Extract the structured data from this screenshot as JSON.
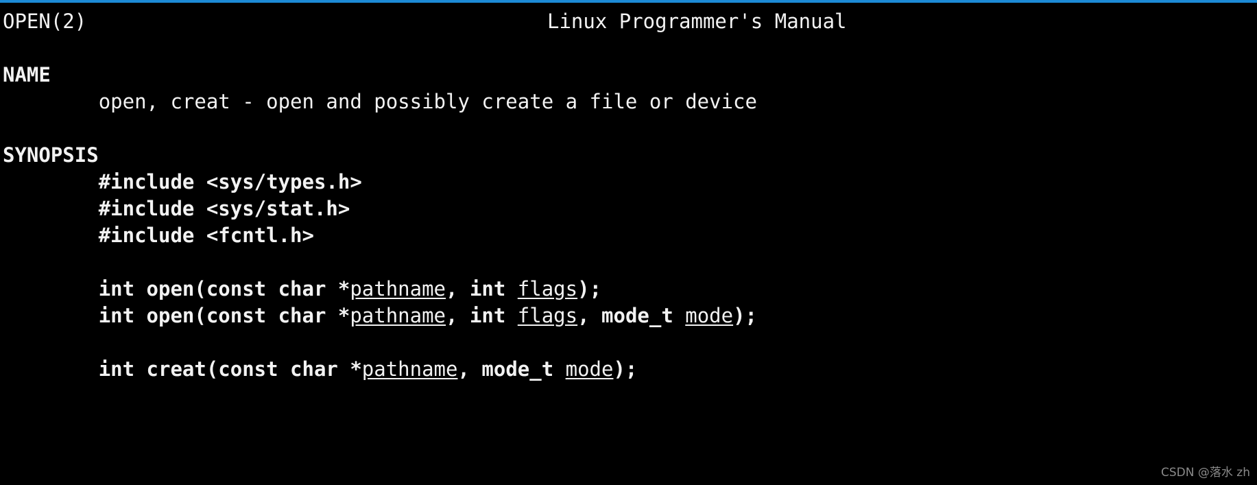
{
  "theme": {
    "background": "#000000",
    "foreground": "#f2f2f2",
    "accent_bar": "#1c8ad6",
    "watermark_color": "#8a8a8a"
  },
  "header": {
    "left": "OPEN(2)",
    "center": "Linux Programmer's Manual"
  },
  "sections": [
    {
      "heading": "NAME",
      "lines": [
        {
          "indent": 8,
          "segments": [
            {
              "text": "open, creat - open and possibly create a file or device",
              "style": "plain"
            }
          ]
        }
      ]
    },
    {
      "heading": "SYNOPSIS",
      "lines": [
        {
          "indent": 8,
          "segments": [
            {
              "text": "#include <sys/types.h>",
              "style": "bold"
            }
          ]
        },
        {
          "indent": 8,
          "segments": [
            {
              "text": "#include <sys/stat.h>",
              "style": "bold"
            }
          ]
        },
        {
          "indent": 8,
          "segments": [
            {
              "text": "#include <fcntl.h>",
              "style": "bold"
            }
          ]
        },
        {
          "indent": 0,
          "blank": true,
          "segments": []
        },
        {
          "indent": 8,
          "segments": [
            {
              "text": "int open(const char *",
              "style": "bold"
            },
            {
              "text": "pathname",
              "style": "underline"
            },
            {
              "text": ", int ",
              "style": "bold"
            },
            {
              "text": "flags",
              "style": "underline"
            },
            {
              "text": ");",
              "style": "bold"
            }
          ]
        },
        {
          "indent": 8,
          "segments": [
            {
              "text": "int open(const char *",
              "style": "bold"
            },
            {
              "text": "pathname",
              "style": "underline"
            },
            {
              "text": ", int ",
              "style": "bold"
            },
            {
              "text": "flags",
              "style": "underline"
            },
            {
              "text": ", mode_t ",
              "style": "bold"
            },
            {
              "text": "mode",
              "style": "underline"
            },
            {
              "text": ");",
              "style": "bold"
            }
          ]
        },
        {
          "indent": 0,
          "blank": true,
          "segments": []
        },
        {
          "indent": 8,
          "segments": [
            {
              "text": "int creat(const char *",
              "style": "bold"
            },
            {
              "text": "pathname",
              "style": "underline"
            },
            {
              "text": ", mode_t ",
              "style": "bold"
            },
            {
              "text": "mode",
              "style": "underline"
            },
            {
              "text": ");",
              "style": "bold"
            }
          ]
        }
      ]
    }
  ],
  "watermark": "CSDN @落水 zh"
}
